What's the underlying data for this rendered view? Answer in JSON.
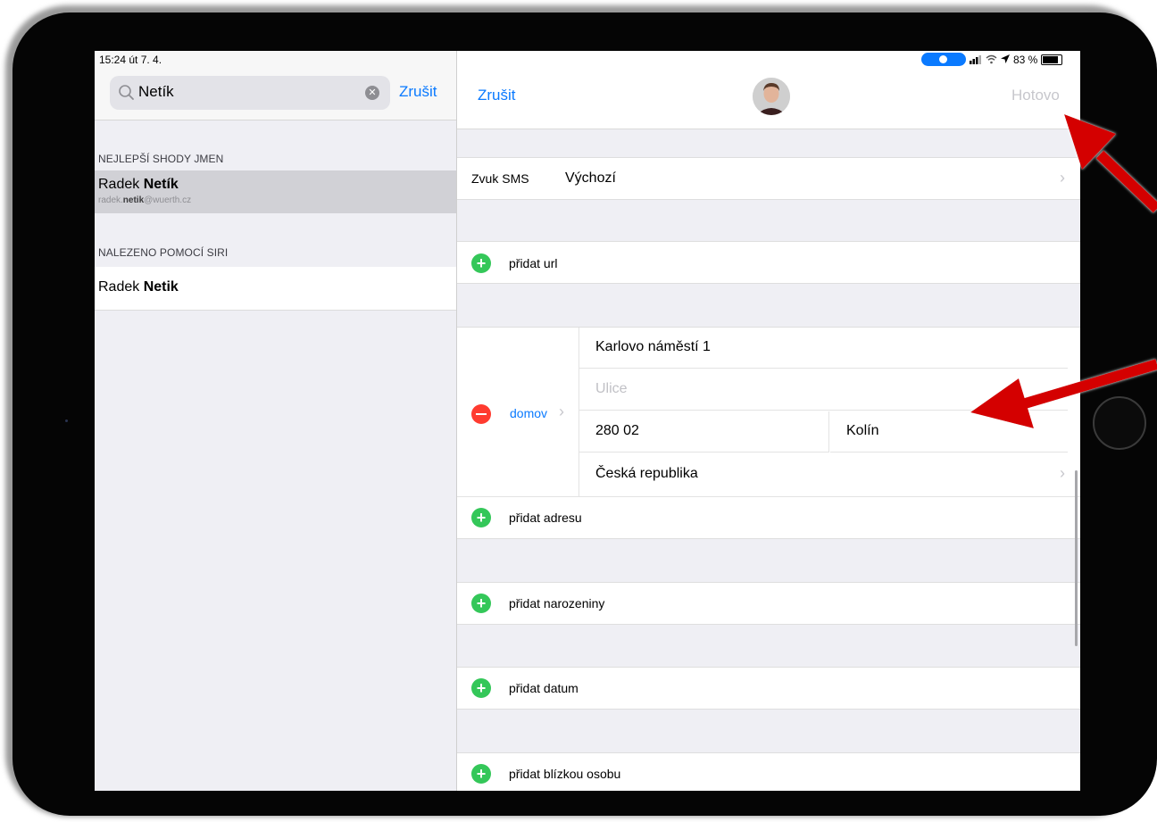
{
  "status_bar": {
    "time_date": "15:24  út 7. 4.",
    "battery_percent": "83 %",
    "battery_level": 0.83
  },
  "search": {
    "value": "Netík",
    "cancel_label": "Zrušit"
  },
  "results": {
    "best_matches_header": "NEJLEPŠÍ SHODY JMEN",
    "best_match": {
      "first_name": "Radek",
      "last_name": "Netík",
      "email_prefix": "radek.",
      "email_match": "netik",
      "email_suffix": "@wuerth.cz"
    },
    "siri_header": "NALEZENO POMOCÍ SIRI",
    "siri_match": {
      "first_name": "Radek",
      "last_name": "Netik"
    }
  },
  "editor": {
    "cancel_label": "Zrušit",
    "done_label": "Hotovo",
    "sms_sound_label": "Zvuk SMS",
    "sms_sound_value": "Výchozí",
    "add_url": "přidat url",
    "address_label": "domov",
    "address": {
      "street": "Karlovo náměstí 1",
      "street2_placeholder": "Ulice",
      "zip": "280 02",
      "city": "Kolín",
      "country": "Česká republika"
    },
    "add_address": "přidat adresu",
    "add_birthday": "přidat narozeniny",
    "add_date": "přidat datum",
    "add_related": "přidat blízkou osobu"
  },
  "colors": {
    "accent": "#0a7aff",
    "add_green": "#34c759",
    "remove_red": "#ff3b30",
    "annotation_arrow": "#d40000"
  },
  "icons": [
    "search-icon",
    "clear-icon",
    "chevron-right-icon",
    "add-icon",
    "remove-icon",
    "wifi-icon",
    "location-icon",
    "battery-icon",
    "signal-icon"
  ]
}
